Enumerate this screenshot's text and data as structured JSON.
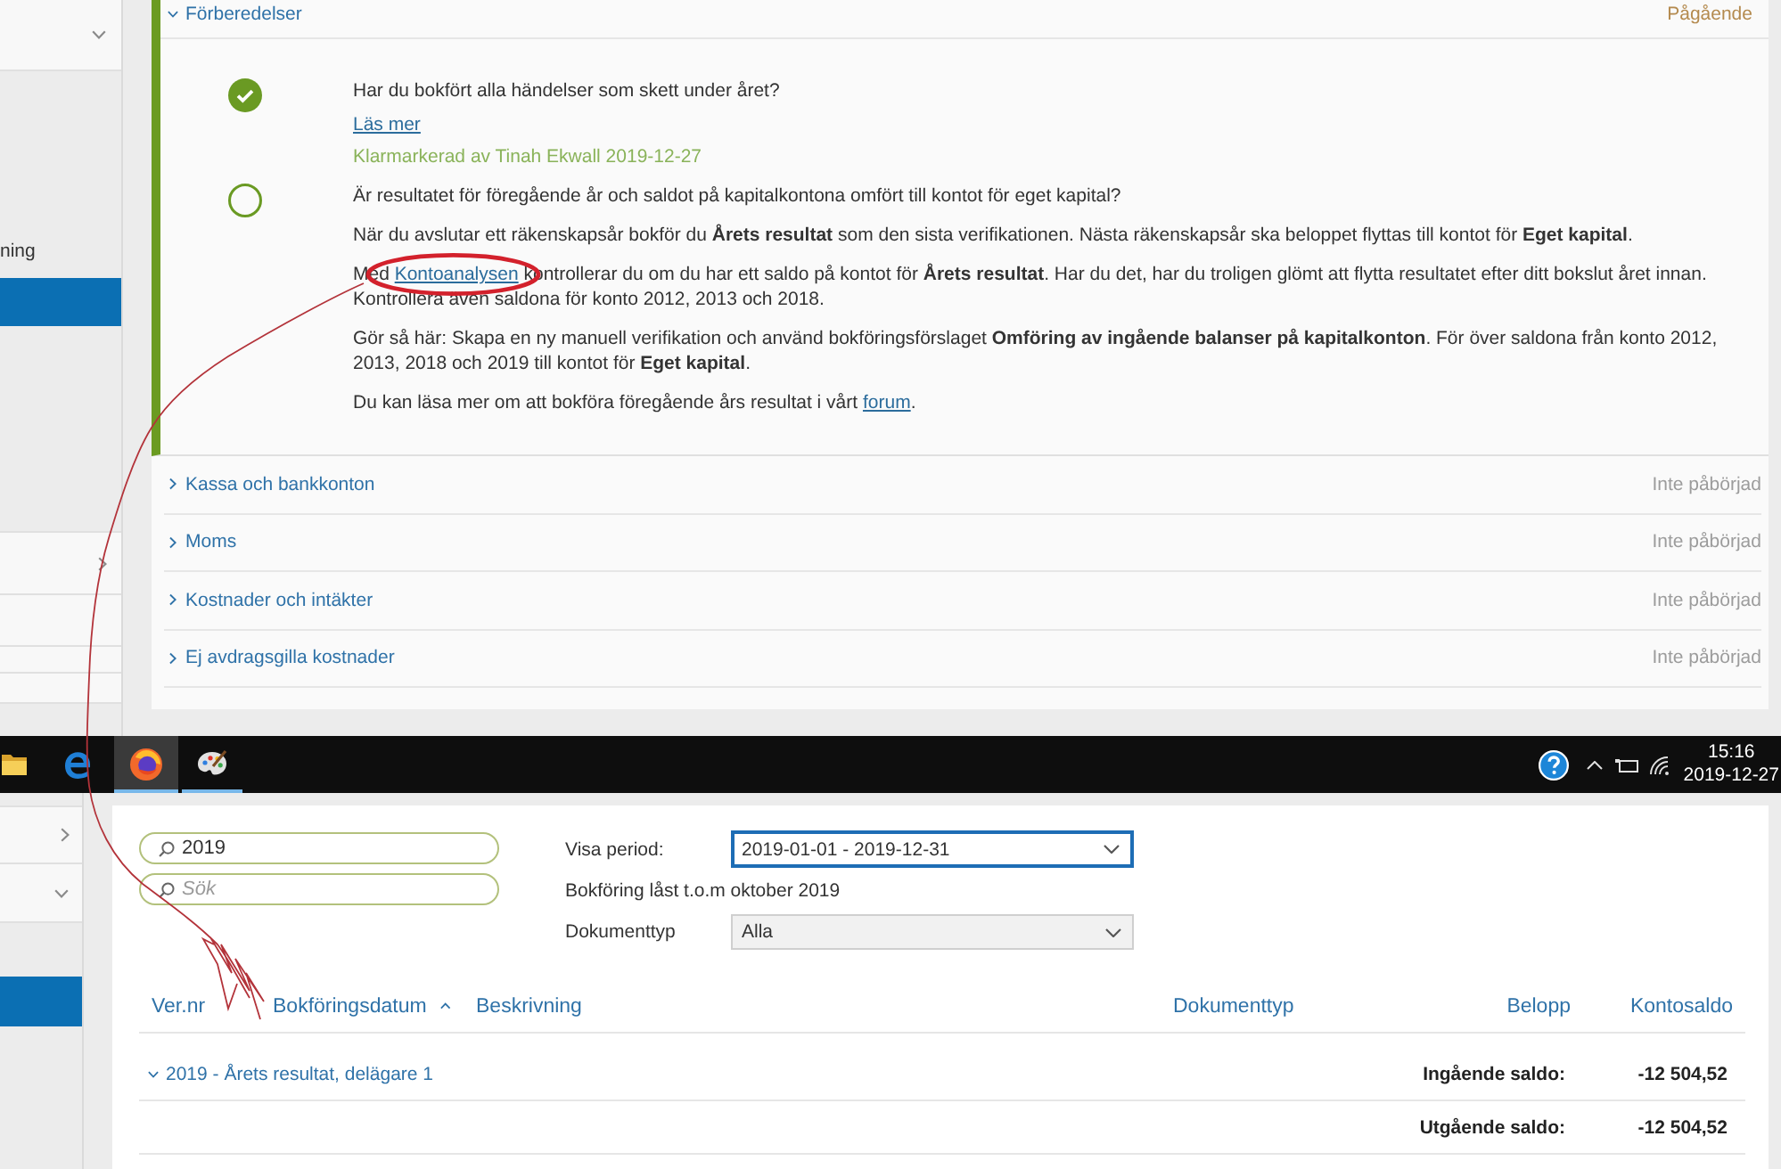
{
  "top_window": {
    "sidebar": {
      "items": [
        {
          "kind": "group",
          "expanded": true,
          "selected": false
        },
        {
          "kind": "link",
          "label": "ning",
          "selected": false
        },
        {
          "kind": "link",
          "selected": true
        },
        {
          "kind": "group",
          "expanded": false,
          "selected": false
        },
        {
          "kind": "row",
          "selected": false
        },
        {
          "kind": "row",
          "selected": false
        },
        {
          "kind": "row",
          "selected": false
        }
      ]
    },
    "checklist": [
      {
        "title": "Förberedelser",
        "status": "Pågående",
        "started": true,
        "expanded": true,
        "tasks": [
          {
            "done": true,
            "question": "Har du bokfört alla händelser som skett under året?",
            "link": "Läs mer",
            "note": "Klarmarkerad av Tinah Ekwall 2019-12-27"
          },
          {
            "done": false,
            "question": "Är resultatet för föregående år och saldot på kapitalkontona omfört till kontot för eget kapital?",
            "paragraphs": [
              [
                {
                  "kind": "text",
                  "text": "När du avslutar ett räkenskapsår bokför du **Årets resultat** som den sista verifikationen. Nästa räkenskapsår ska beloppet flyttas till kontot för **Eget kapital**."
                }
              ],
              [
                {
                  "kind": "text",
                  "text": "Med "
                },
                {
                  "kind": "link",
                  "text": "Kontoanalysen",
                  "circled": true
                },
                {
                  "kind": "text",
                  "text": " kontrollerar du om du har ett saldo på kontot för **Årets resultat**. Har du det, har du troligen glömt att flytta resultatet efter ditt bokslut året innan. Kontrollera även saldona för konto 2012, 2013 och 2018."
                }
              ],
              [
                {
                  "kind": "text",
                  "text": "Gör så här: Skapa en ny manuell verifikation och använd bokföringsförslaget **Omföring av ingående balanser på kapitalkonton**. För över saldona från konto 2012, 2013, 2018 och 2019 till kontot för **Eget kapital**."
                }
              ],
              [
                {
                  "kind": "text",
                  "text": "Du kan läsa mer om att bokföra föregående års resultat i vårt "
                },
                {
                  "kind": "link",
                  "text": "forum"
                },
                {
                  "kind": "text",
                  "text": "."
                }
              ]
            ]
          }
        ]
      },
      {
        "title": "Kassa och bankkonton",
        "status": "Inte påbörjad",
        "started": false,
        "expanded": false
      },
      {
        "title": "Moms",
        "status": "Inte påbörjad",
        "started": false,
        "expanded": false
      },
      {
        "title": "Kostnader och intäkter",
        "status": "Inte påbörjad",
        "started": false,
        "expanded": false
      },
      {
        "title": "Ej avdragsgilla kostnader",
        "status": "Inte påbörjad",
        "started": false,
        "expanded": false
      }
    ]
  },
  "taskbar": {
    "apps": [
      {
        "kind": "folder",
        "selected": false,
        "running": false
      },
      {
        "kind": "edge",
        "selected": false,
        "running": false
      },
      {
        "kind": "firefox",
        "selected": true,
        "running": true
      },
      {
        "kind": "paint",
        "selected": false,
        "running": true
      }
    ],
    "time": "15:16",
    "date": "2019-12-27"
  },
  "bottom_window": {
    "sidebar": {
      "items": [
        {
          "kind": "group",
          "expanded": false,
          "selected": false
        },
        {
          "kind": "group",
          "expanded": true,
          "selected": false
        },
        {
          "kind": "link",
          "selected": true
        }
      ]
    },
    "searches": [
      {
        "value": "2019"
      },
      {
        "placeholder": "Sök"
      }
    ],
    "filters": [
      {
        "kind": "select",
        "label": "Visa period:",
        "value": "2019-01-01 - 2019-12-31",
        "focused": true
      },
      {
        "kind": "note",
        "text": "Bokföring låst t.o.m oktober 2019"
      },
      {
        "kind": "select",
        "label": "Dokumenttyp",
        "value": "Alla",
        "focused": false
      }
    ],
    "table": {
      "columns": [
        {
          "label": "Ver.nr",
          "sorted": false
        },
        {
          "label": "Bokföringsdatum",
          "sorted": true
        },
        {
          "label": "Beskrivning",
          "sorted": false
        },
        {
          "label": "Dokumenttyp",
          "sorted": false
        },
        {
          "label": "Belopp",
          "sorted": false
        },
        {
          "label": "Kontosaldo",
          "sorted": false
        }
      ],
      "groups": [
        {
          "title": "2019 - Årets resultat, delägare 1",
          "expanded": true,
          "rows": [
            {
              "label": "Ingående saldo:",
              "value": "-12 504,52"
            },
            {
              "label": "Utgående saldo:",
              "value": "-12 504,52"
            }
          ]
        }
      ]
    }
  }
}
